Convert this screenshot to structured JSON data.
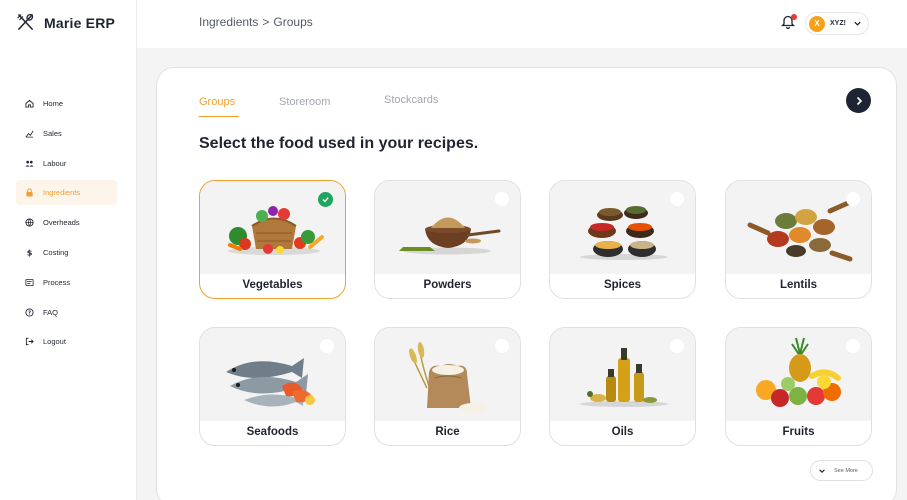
{
  "app": {
    "name": "Marie ERP"
  },
  "sidebar": {
    "items": [
      {
        "label": "Home",
        "icon": "home-icon",
        "active": false
      },
      {
        "label": "Sales",
        "icon": "sales-icon",
        "active": false
      },
      {
        "label": "Labour",
        "icon": "users-icon",
        "active": false
      },
      {
        "label": "Ingredients",
        "icon": "lock-icon",
        "active": true
      },
      {
        "label": "Overheads",
        "icon": "globe-icon",
        "active": false
      },
      {
        "label": "Costing",
        "icon": "dollar-icon",
        "active": false
      },
      {
        "label": "Process",
        "icon": "process-icon",
        "active": false
      },
      {
        "label": "FAQ",
        "icon": "question-icon",
        "active": false
      },
      {
        "label": "Logout",
        "icon": "logout-icon",
        "active": false
      }
    ]
  },
  "header": {
    "breadcrumb": [
      "Ingredients",
      ">",
      "Groups"
    ],
    "user": {
      "initial": "X",
      "name": "XYZ!"
    }
  },
  "tabs": [
    {
      "label": "Groups",
      "active": true
    },
    {
      "label": "Storeroom",
      "active": false
    },
    {
      "label": "Stockcards",
      "active": false
    }
  ],
  "heading": "Select the food used in your recipes.",
  "groups": [
    {
      "label": "Vegetables",
      "selected": true
    },
    {
      "label": "Powders",
      "selected": false
    },
    {
      "label": "Spices",
      "selected": false
    },
    {
      "label": "Lentils",
      "selected": false
    },
    {
      "label": "Seafoods",
      "selected": false
    },
    {
      "label": "Rice",
      "selected": false
    },
    {
      "label": "Oils",
      "selected": false
    },
    {
      "label": "Fruits",
      "selected": false
    }
  ],
  "see_more": "See More",
  "colors": {
    "accent": "#f0a030",
    "dark": "#1d2434",
    "check": "#1fa55c"
  }
}
